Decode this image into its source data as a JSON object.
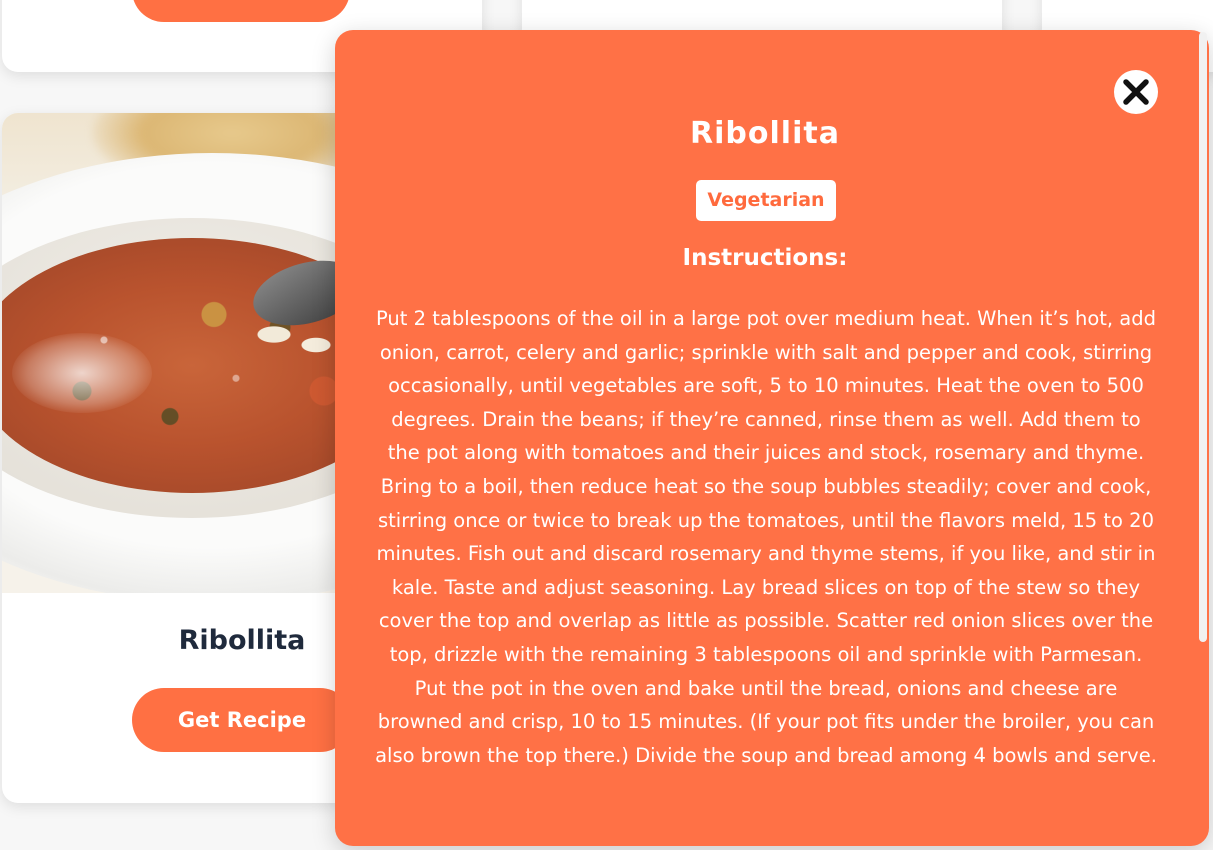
{
  "card": {
    "title": "Ribollita",
    "button_label": "Get Recipe",
    "image_icon": "ribollita-photo"
  },
  "modal": {
    "title": "Ribollita",
    "category": "Vegetarian",
    "instructions_heading": "Instructions:",
    "instructions": "Put 2 tablespoons of the oil in a large pot over medium heat. When it’s hot, add onion, carrot, celery and garlic; sprinkle with salt and pepper and cook, stirring occasionally, until vegetables are soft, 5 to 10 minutes. Heat the oven to 500 degrees. Drain the beans; if they’re canned, rinse them as well. Add them to the pot along with tomatoes and their juices and stock, rosemary and thyme. Bring to a boil, then reduce heat so the soup bubbles steadily; cover and cook, stirring once or twice to break up the tomatoes, until the flavors meld, 15 to 20 minutes. Fish out and discard rosemary and thyme stems, if you like, and stir in kale. Taste and adjust seasoning. Lay bread slices on top of the stew so they cover the top and overlap as little as possible. Scatter red onion slices over the top, drizzle with the remaining 3 tablespoons oil and sprinkle with Parmesan. Put the pot in the oven and bake until the bread, onions and cheese are browned and crisp, 10 to 15 minutes. (If your pot fits under the broiler, you can also brown the top there.) Divide the soup and bread among 4 bowls and serve.",
    "close_icon": "close-icon"
  },
  "colors": {
    "accent": "#ff7043",
    "modal_background": "#ff7146",
    "title_text": "#1f2a3c",
    "white": "#ffffff"
  }
}
